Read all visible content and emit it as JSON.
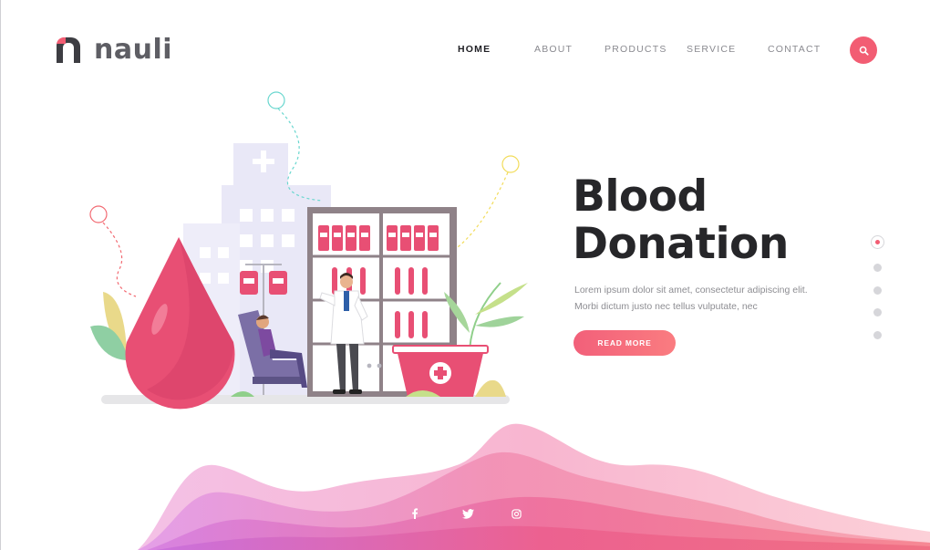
{
  "brand": {
    "name": "nauli",
    "logo_letter": "n"
  },
  "nav": {
    "items": [
      {
        "label": "HOME",
        "active": true
      },
      {
        "label": "ABOUT",
        "active": false
      },
      {
        "label": "PRODUCTS",
        "active": false
      },
      {
        "label": "SERVICE",
        "active": false
      },
      {
        "label": "CONTACT",
        "active": false
      }
    ],
    "search_icon": "search-icon"
  },
  "hero": {
    "title_line1": "Blood",
    "title_line2": "Donation",
    "description": "Lorem ipsum dolor sit amet, consectetur adipiscing elit. Morbi dictum justo nec tellus vulputate, nec",
    "button_label": "READ MORE"
  },
  "slider": {
    "count": 5,
    "active_index": 0
  },
  "social": [
    "facebook-icon",
    "twitter-icon",
    "instagram-icon"
  ],
  "colors": {
    "accent": "#f25d73",
    "dark_text": "#262629",
    "muted_text": "#8d8d92",
    "wave_pink": "#f7a3bd",
    "wave_violet": "#d987e0",
    "building": "#e9e8f7"
  }
}
